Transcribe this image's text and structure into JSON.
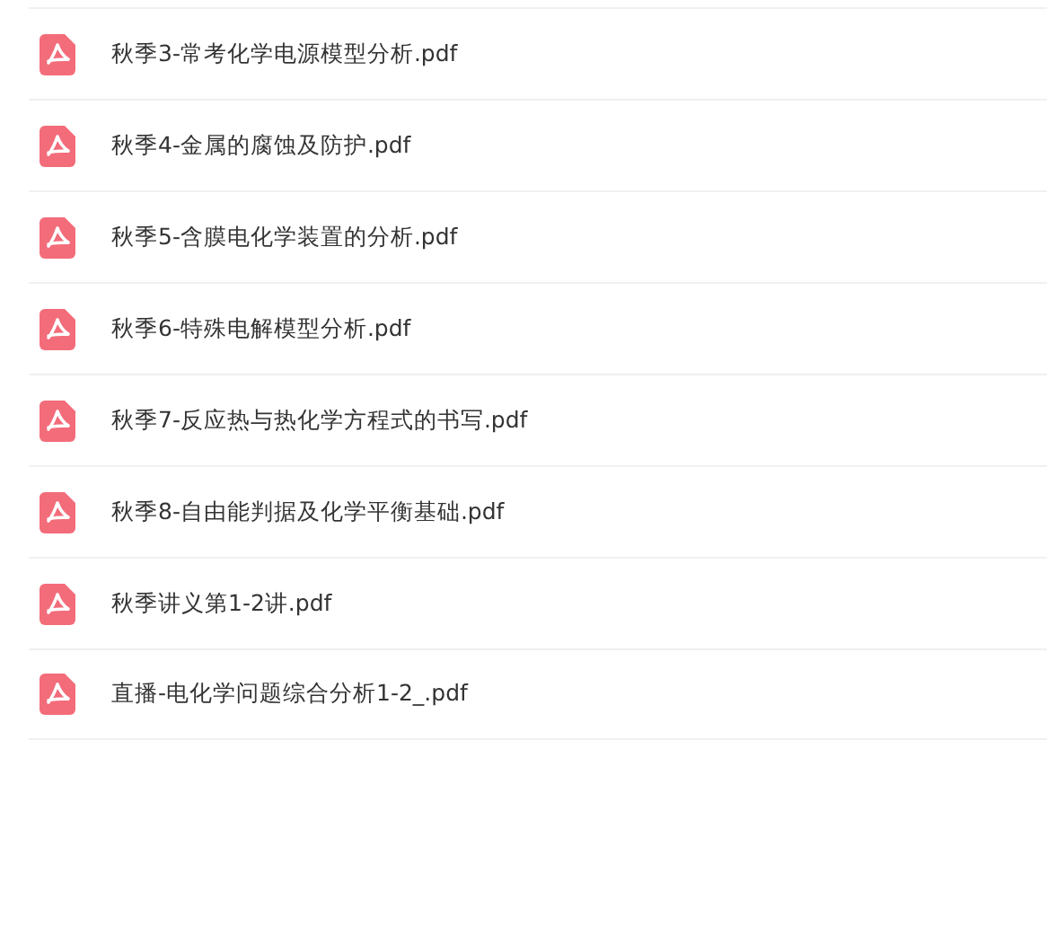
{
  "files": [
    {
      "name": "秋季3-常考化学电源模型分析.pdf"
    },
    {
      "name": "秋季4-金属的腐蚀及防护.pdf"
    },
    {
      "name": "秋季5-含膜电化学装置的分析.pdf"
    },
    {
      "name": "秋季6-特殊电解模型分析.pdf"
    },
    {
      "name": "秋季7-反应热与热化学方程式的书写.pdf"
    },
    {
      "name": "秋季8-自由能判据及化学平衡基础.pdf"
    },
    {
      "name": "秋季讲义第1-2讲.pdf"
    },
    {
      "name": "直播-电化学问题综合分析1-2_.pdf"
    }
  ]
}
